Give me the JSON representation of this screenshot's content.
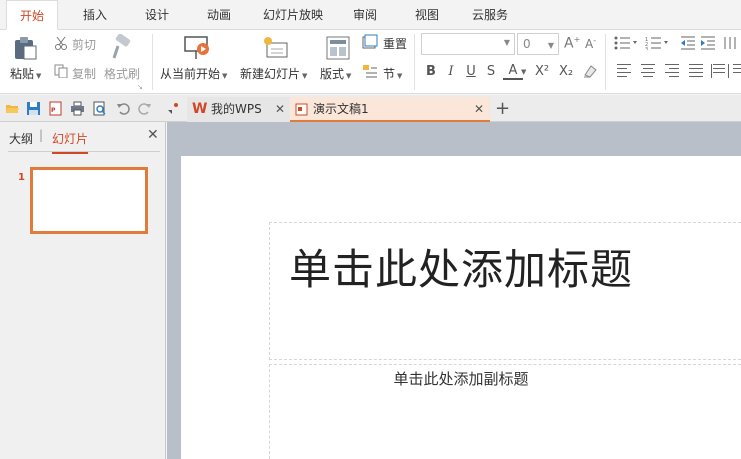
{
  "menu_tabs": [
    "开始",
    "插入",
    "设计",
    "动画",
    "幻灯片放映",
    "审阅",
    "视图",
    "云服务"
  ],
  "ribbon": {
    "paste": "粘贴",
    "cut": "剪切",
    "copy": "复制",
    "format_painter": "格式刷",
    "from_current": "从当前开始",
    "new_slide": "新建幻灯片",
    "layout": "版式",
    "reset": "重置",
    "section": "节",
    "font_name": "",
    "font_size": "0",
    "bold": "B",
    "italic": "I",
    "underline": "U",
    "strike": "S",
    "font_color": "A",
    "superscript": "X²",
    "subscript": "X₂"
  },
  "doc_tabs": {
    "wps": "我的WPS",
    "doc": "演示文稿1"
  },
  "left_pane": {
    "outline": "大纲",
    "slides": "幻灯片",
    "slide_number": "1"
  },
  "slide": {
    "title_placeholder": "单击此处添加标题",
    "subtitle_placeholder": "单击此处添加副标题"
  },
  "colors": {
    "accent": "#d24726",
    "thumb_border": "#e07b3c",
    "canvas_bg": "#b9bfc8"
  }
}
